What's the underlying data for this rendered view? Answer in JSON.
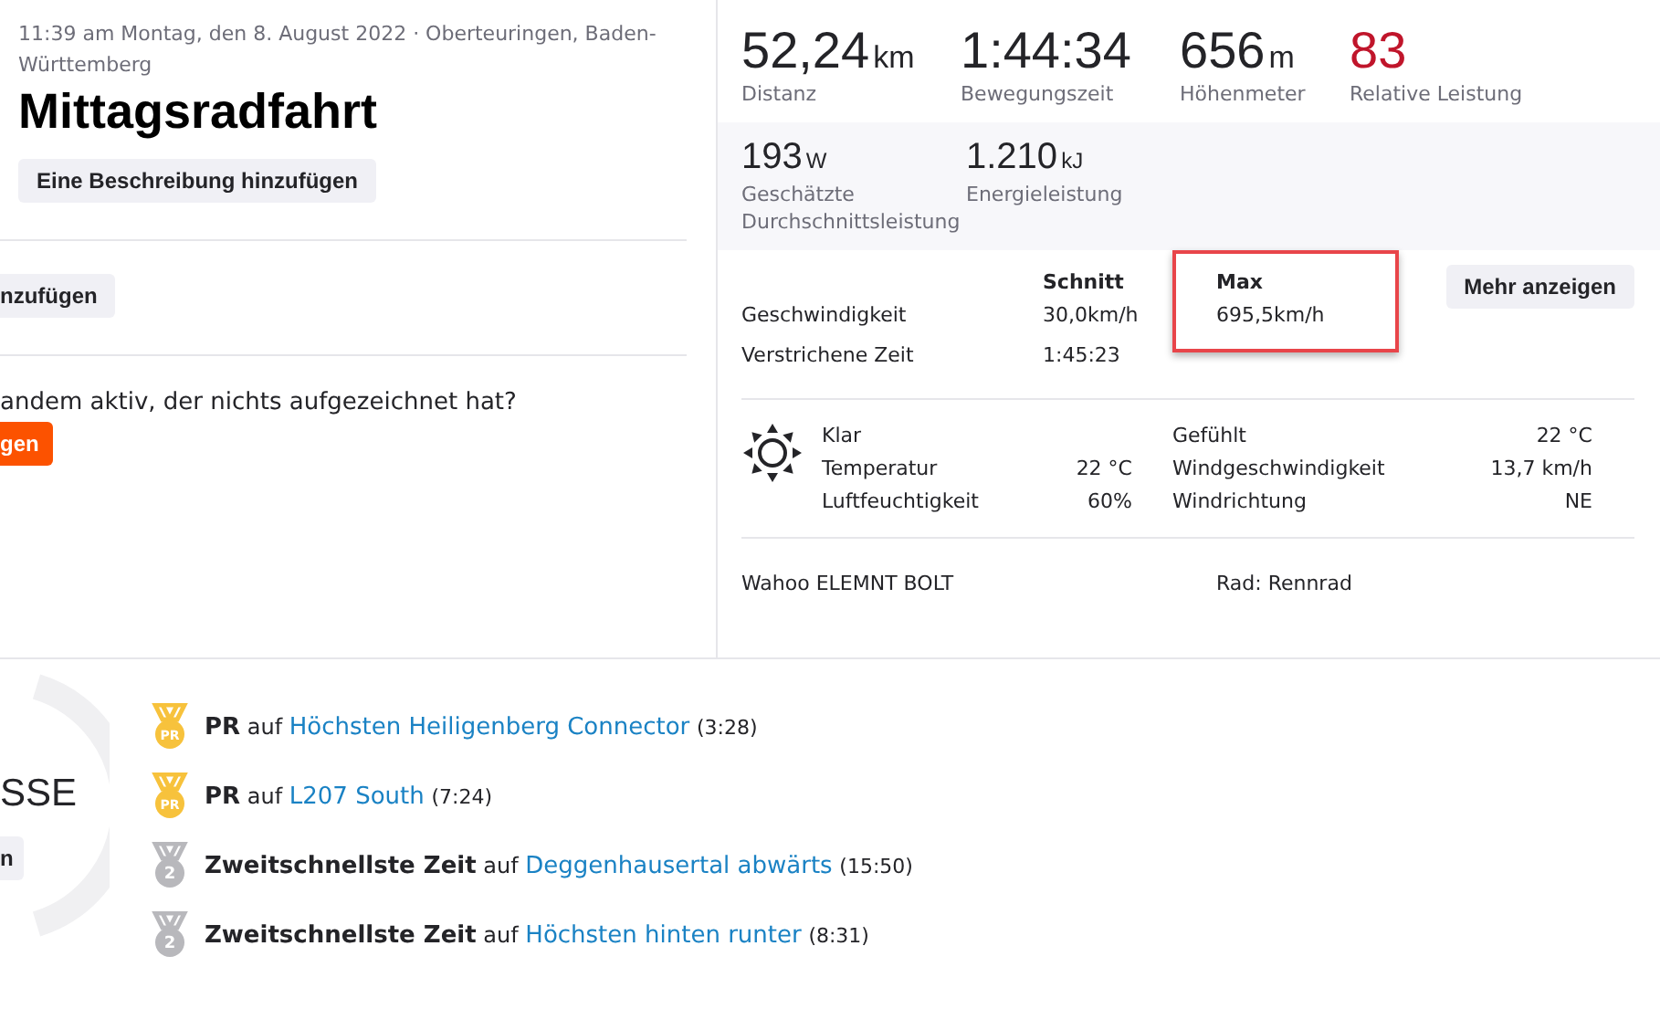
{
  "activity": {
    "timestamp": "11:39 am Montag, den 8. August 2022 · Oberteuringen, Baden-Württemberg",
    "title": "Mittagsradfahrt",
    "description_button": "Eine Beschreibung hinzufügen",
    "cut_button": "nzufügen",
    "question": "andem aktiv, der nichts aufgezeichnet hat?",
    "cut_action_button": "gen"
  },
  "primary_stats": [
    {
      "value": "52,24",
      "unit": "km",
      "label": "Distanz",
      "kind": "plain"
    },
    {
      "value": "1:44:34",
      "label": "Bewegungszeit",
      "kind": "plain"
    },
    {
      "value": "656",
      "unit": "m",
      "label": "Höhenmeter",
      "kind": "plain"
    },
    {
      "value": "83",
      "label": "Relative Leistung",
      "kind": "effort"
    }
  ],
  "secondary_stats": [
    {
      "value": "193",
      "unit": "W",
      "label": "Geschätzte Durchschnittsleistung"
    },
    {
      "value": "1.210",
      "unit": "kJ",
      "label": "Energieleistung"
    }
  ],
  "details": {
    "columns": [
      {
        "label": "Schnitt",
        "highlighted": false
      },
      {
        "label": "Max",
        "highlighted": true
      }
    ],
    "more_button": "Mehr anzeigen",
    "rows": [
      {
        "label": "Geschwindigkeit",
        "values": [
          "30,0km/h",
          "695,5km/h"
        ]
      },
      {
        "label": "Verstrichene Zeit",
        "values": [
          "1:45:23"
        ]
      }
    ]
  },
  "weather": {
    "left": [
      {
        "label": "Klar"
      },
      {
        "label": "Temperatur",
        "value": "22 °C"
      },
      {
        "label": "Luftfeuchtigkeit",
        "value": "60%"
      }
    ],
    "right": [
      {
        "label": "Gefühlt",
        "value": "22 °C"
      },
      {
        "label": "Windgeschwindigkeit",
        "value": "13,7 km/h"
      },
      {
        "label": "Windrichtung",
        "value": "NE"
      }
    ]
  },
  "device": "Wahoo ELEMNT BOLT",
  "bike": "Rad: Rennrad",
  "achievements_panel": {
    "cut_title": "SSE",
    "cut_button": "n"
  },
  "achievements": [
    {
      "kind": "pr",
      "badge": "PR",
      "title": "PR",
      "connector": "auf",
      "segment": "Höchsten Heiligenberg Connector",
      "time": "(3:28)"
    },
    {
      "kind": "pr",
      "badge": "PR",
      "title": "PR",
      "connector": "auf",
      "segment": "L207 South",
      "time": "(7:24)"
    },
    {
      "kind": "second",
      "badge": "2",
      "title": "Zweitschnellste Zeit",
      "connector": "auf",
      "segment": "Deggenhausertal abwärts",
      "time": "(15:50)"
    },
    {
      "kind": "second",
      "badge": "2",
      "title": "Zweitschnellste Zeit",
      "connector": "auf",
      "segment": "Höchsten hinten runter",
      "time": "(8:31)"
    }
  ]
}
